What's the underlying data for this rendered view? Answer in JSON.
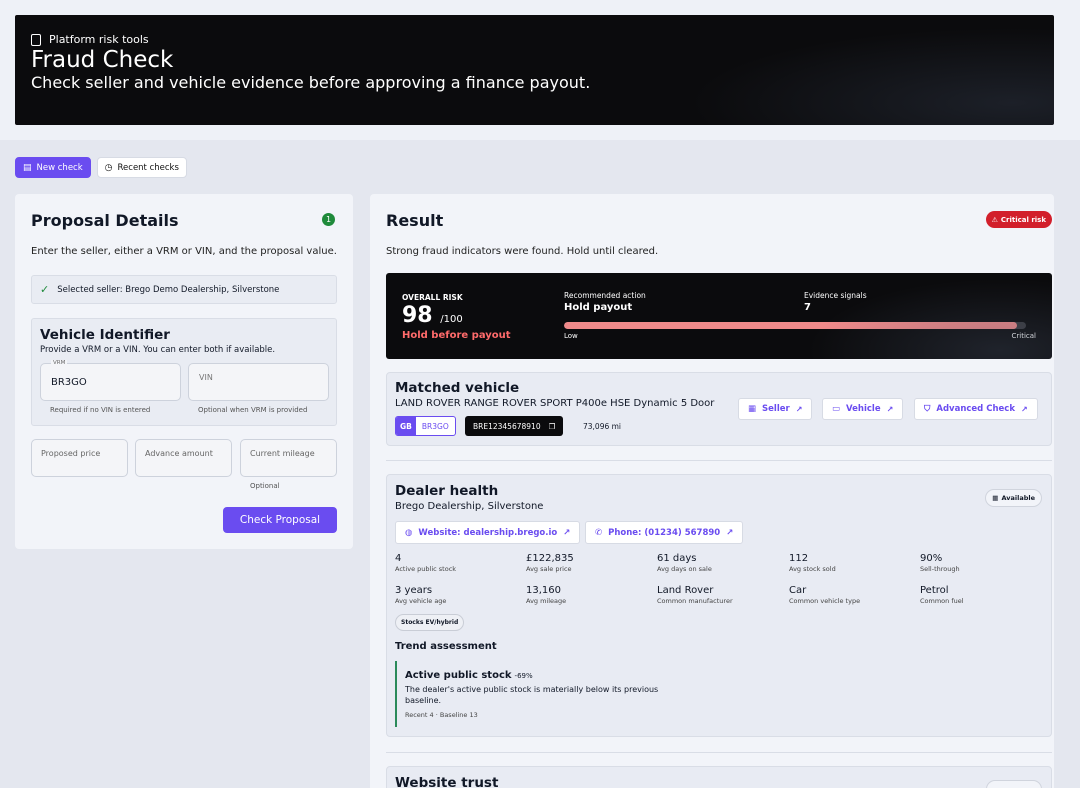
{
  "header": {
    "kicker": "Platform risk tools",
    "title": "Fraud Check",
    "subtitle": "Check seller and vehicle evidence before approving a finance payout."
  },
  "tabs": [
    {
      "label": "New check",
      "icon": "document-icon",
      "active": true
    },
    {
      "label": "Recent checks",
      "icon": "clock-icon",
      "active": false
    }
  ],
  "proposal": {
    "title": "Proposal Details",
    "step_badge": "1",
    "intro": "Enter the seller, either a VRM or VIN, and the proposal value.",
    "selected_seller": "Selected seller: Brego Demo Dealership, Silverstone",
    "vehicle_identifier": {
      "title": "Vehicle Identifier",
      "subtitle": "Provide a VRM or a VIN. You can enter both if available.",
      "vrm_label": "VRM",
      "vrm_value": "BR3GO",
      "vrm_hint": "Required if no VIN is entered",
      "vin_placeholder": "VIN",
      "vin_hint": "Optional when VRM is provided"
    },
    "proposed_price_placeholder": "Proposed price",
    "advance_amount_placeholder": "Advance amount",
    "current_mileage_placeholder": "Current mileage",
    "mileage_hint": "Optional",
    "submit_label": "Check Proposal"
  },
  "result": {
    "title": "Result",
    "risk_badge": "Critical risk",
    "summary": "Strong fraud indicators were found. Hold until cleared.",
    "overall": {
      "label": "OVERALL RISK",
      "score": "98",
      "score_max": "/100",
      "status": "Hold before payout",
      "action_label": "Recommended action",
      "action_value": "Hold payout",
      "signals_label": "Evidence signals",
      "signals_value": "7",
      "bar_fraction": 0.98,
      "low_label": "Low",
      "critical_label": "Critical"
    },
    "matched_vehicle": {
      "title": "Matched vehicle",
      "model": "LAND ROVER RANGE ROVER SPORT P400e HSE Dynamic 5 Door",
      "plate_country": "GB",
      "plate_reg": "BR3GO",
      "vin": "BRE12345678910",
      "mileage": "73,096 mi",
      "links": {
        "seller": "Seller",
        "vehicle": "Vehicle",
        "advanced": "Advanced Check"
      }
    },
    "dealer_health": {
      "title": "Dealer health",
      "name": "Brego Dealership, Silverstone",
      "status": "Available",
      "website": "Website: dealership.brego.io",
      "phone": "Phone: (01234) 567890",
      "stats": [
        {
          "value": "4",
          "label": "Active public stock"
        },
        {
          "value": "£122,835",
          "label": "Avg sale price"
        },
        {
          "value": "61 days",
          "label": "Avg days on sale"
        },
        {
          "value": "112",
          "label": "Avg stock sold"
        },
        {
          "value": "90%",
          "label": "Sell-through"
        },
        {
          "value": "3 years",
          "label": "Avg vehicle age"
        },
        {
          "value": "13,160",
          "label": "Avg mileage"
        },
        {
          "value": "Land Rover",
          "label": "Common manufacturer"
        },
        {
          "value": "Car",
          "label": "Common vehicle type"
        },
        {
          "value": "Petrol",
          "label": "Common fuel"
        }
      ],
      "ev_badge": "Stocks EV/hybrid",
      "trend_title": "Trend assessment",
      "trend": {
        "title": "Active public stock",
        "change": "-69%",
        "description": "The dealer's active public stock is materially below its previous baseline.",
        "detail": "Recent 4 · Baseline 13"
      }
    },
    "website_trust": {
      "title": "Website trust"
    }
  },
  "colors": {
    "accent": "#6a4cf0",
    "critical": "#d21f2b",
    "success": "#1f8a3b",
    "risk_bar": "#f08a8a"
  }
}
